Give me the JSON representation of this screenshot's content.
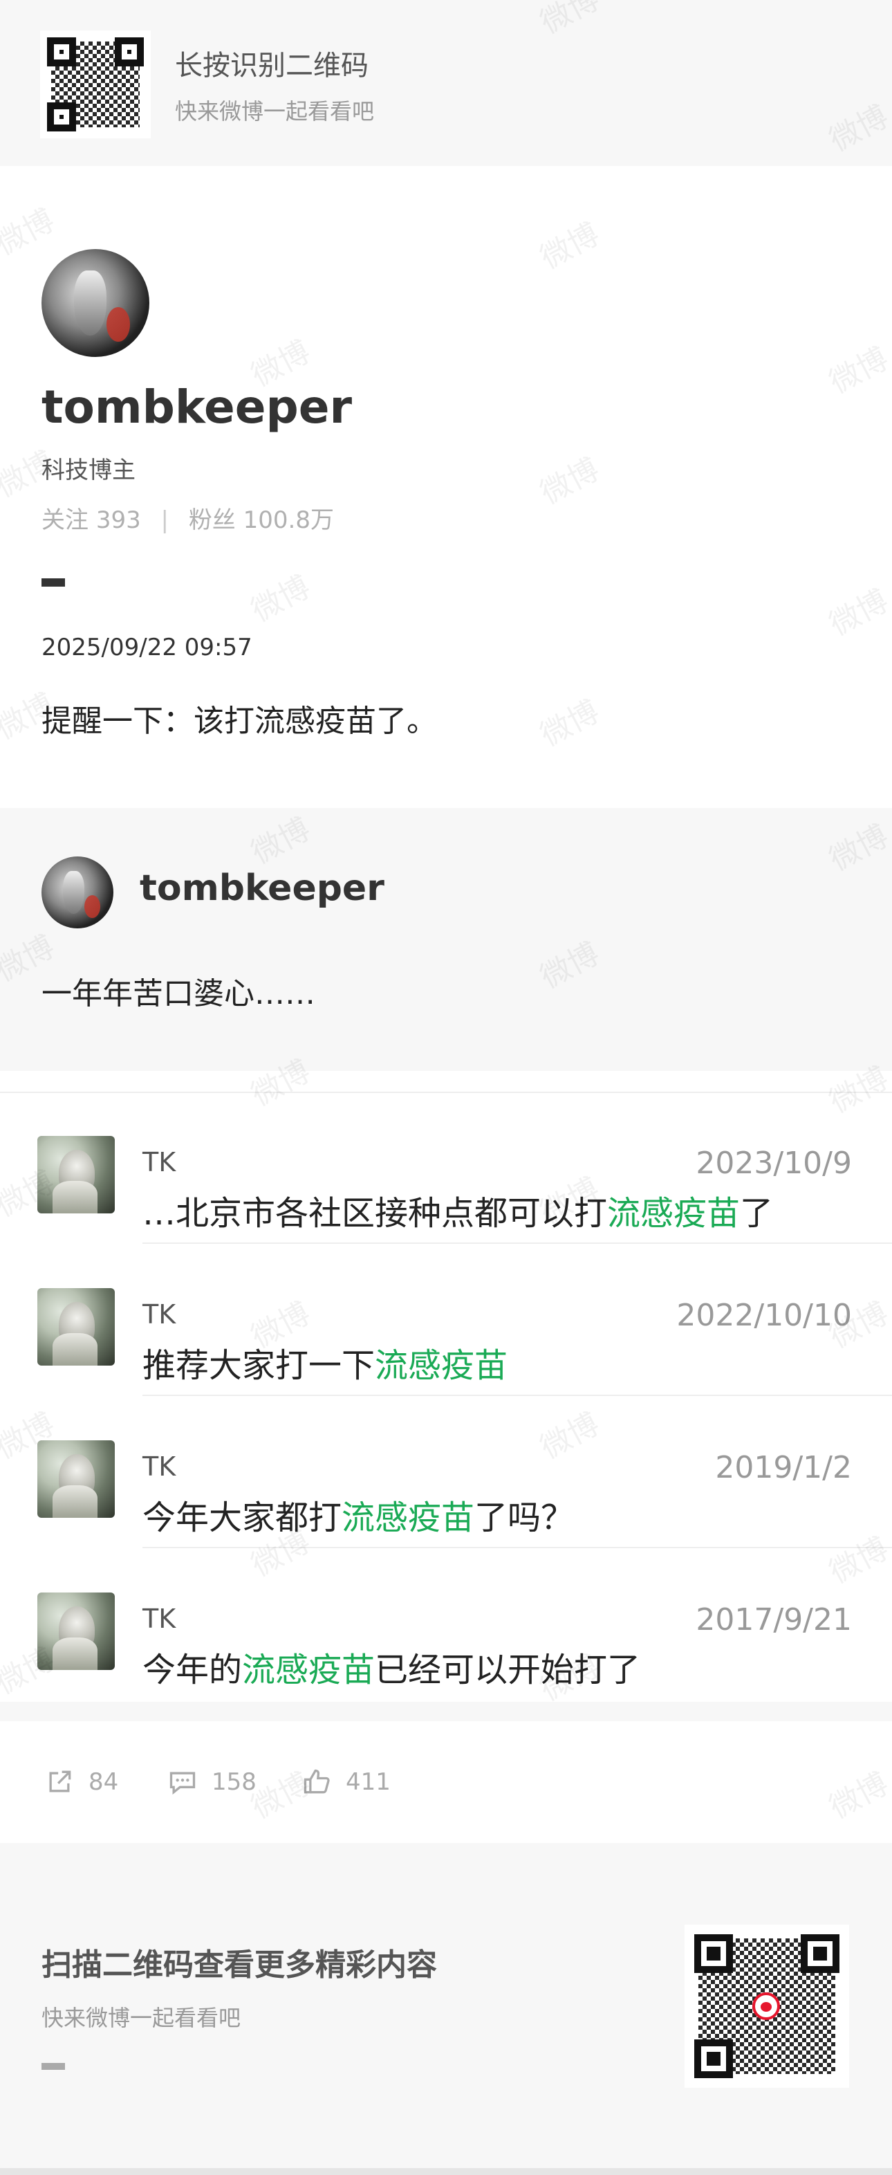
{
  "header": {
    "qr_title": "长按识别二维码",
    "qr_subtitle": "快来微博一起看看吧"
  },
  "author": {
    "name": "tombkeeper",
    "badge": "科技博主",
    "follow_label": "关注",
    "follow_count": "393",
    "fans_label": "粉丝",
    "fans_count": "100.8万"
  },
  "post": {
    "date": "2025/09/22 09:57",
    "text": "提醒一下：该打流感疫苗了。"
  },
  "repost": {
    "name": "tombkeeper",
    "text": "一年年苦口婆心……"
  },
  "embedded_posts": [
    {
      "author": "TK",
      "date": "2023/10/9",
      "before": "…北京市各社区接种点都可以打",
      "highlight": "流感疫苗",
      "after": "了"
    },
    {
      "author": "TK",
      "date": "2022/10/10",
      "before": "推荐大家打一下",
      "highlight": "流感疫苗",
      "after": ""
    },
    {
      "author": "TK",
      "date": "2019/1/2",
      "before": "今年大家都打",
      "highlight": "流感疫苗",
      "after": "了吗？"
    },
    {
      "author": "TK",
      "date": "2017/9/21",
      "before": "今年的",
      "highlight": "流感疫苗",
      "after": "已经可以开始打了"
    }
  ],
  "actions": {
    "share_count": "84",
    "comment_count": "158",
    "like_count": "411"
  },
  "footer": {
    "title": "扫描二维码查看更多精彩内容",
    "subtitle": "快来微博一起看看吧"
  },
  "watermark": "微博",
  "colors": {
    "highlight": "#1aaa55",
    "brand_red": "#e6162d"
  },
  "icons": [
    "qr-code-icon",
    "share-icon",
    "comment-icon",
    "like-icon",
    "weibo-logo-icon"
  ]
}
